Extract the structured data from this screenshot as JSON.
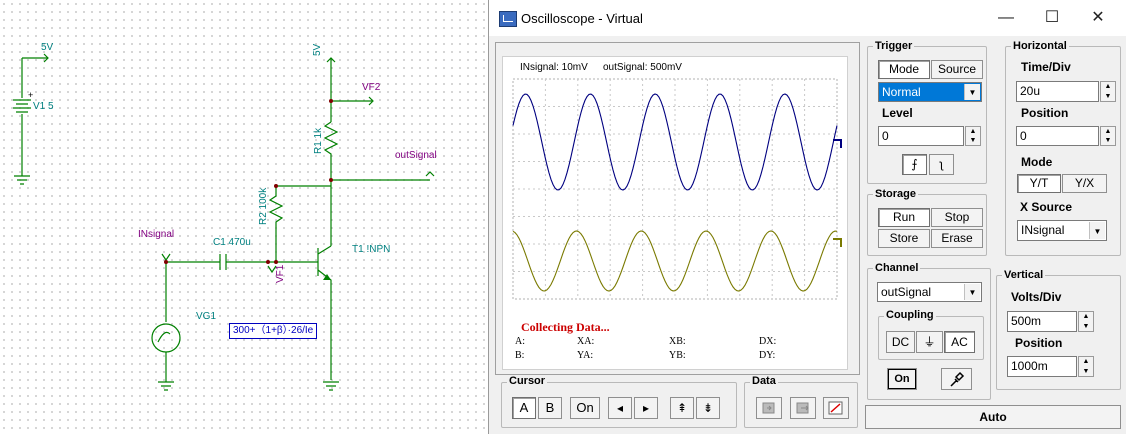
{
  "schematic": {
    "v1_top_label": "5V",
    "v1_name": "V1 5",
    "vcc_label": "5V",
    "vf2_label": "VF2",
    "r1_label": "R1 1k",
    "outsignal_label": "outSignal",
    "r2_label": "R2 100k",
    "insignal_label": "INsignal",
    "c1_label": "C1 470u",
    "vf1_label": "VF1",
    "t1_label": "T1 !NPN",
    "vg1_label": "VG1",
    "formula": "300+（1+β）·26/Ie"
  },
  "window": {
    "title": "Oscilloscope - Virtual",
    "min_glyph": "—",
    "max_glyph": "☐",
    "close_glyph": "✕"
  },
  "scope": {
    "legend_in": "INsignal: 10mV",
    "legend_out": "outSignal: 500mV",
    "status": "Collecting Data...",
    "cursor_labels": {
      "a": "A:",
      "b": "B:",
      "xa": "XA:",
      "ya": "YA:",
      "xb": "XB:",
      "yb": "YB:",
      "dx": "DX:",
      "dy": "DY:"
    },
    "colors": {
      "in_trace": "#7a7a00",
      "out_trace": "#000080"
    }
  },
  "trigger": {
    "title": "Trigger",
    "mode_label": "Mode",
    "source_label": "Source",
    "mode_value": "Normal",
    "level_label": "Level",
    "level_value": "0",
    "rise_glyph": "⨍",
    "fall_glyph": "ʅ"
  },
  "horizontal": {
    "title": "Horizontal",
    "timediv_label": "Time/Div",
    "timediv_value": "20u",
    "position_label": "Position",
    "position_value": "0",
    "mode_label": "Mode",
    "yt_label": "Y/T",
    "yx_label": "Y/X",
    "xsource_label": "X Source",
    "xsource_value": "INsignal"
  },
  "storage": {
    "title": "Storage",
    "run_label": "Run",
    "stop_label": "Stop",
    "store_label": "Store",
    "erase_label": "Erase"
  },
  "channel": {
    "title": "Channel",
    "selected": "outSignal",
    "coupling_title": "Coupling",
    "dc_label": "DC",
    "gnd_glyph": "⏚",
    "ac_label": "AC",
    "on_label": "On"
  },
  "vertical": {
    "title": "Vertical",
    "voltsdiv_label": "Volts/Div",
    "voltsdiv_value": "500m",
    "position_label": "Position",
    "position_value": "1000m"
  },
  "cursor": {
    "title": "Cursor",
    "a_label": "A",
    "b_label": "B",
    "on_label": "On",
    "left_glyph": "◂",
    "right_glyph": "▸",
    "up_glyph": "⇞",
    "down_glyph": "⇟"
  },
  "data": {
    "title": "Data"
  },
  "auto_label": "Auto"
}
